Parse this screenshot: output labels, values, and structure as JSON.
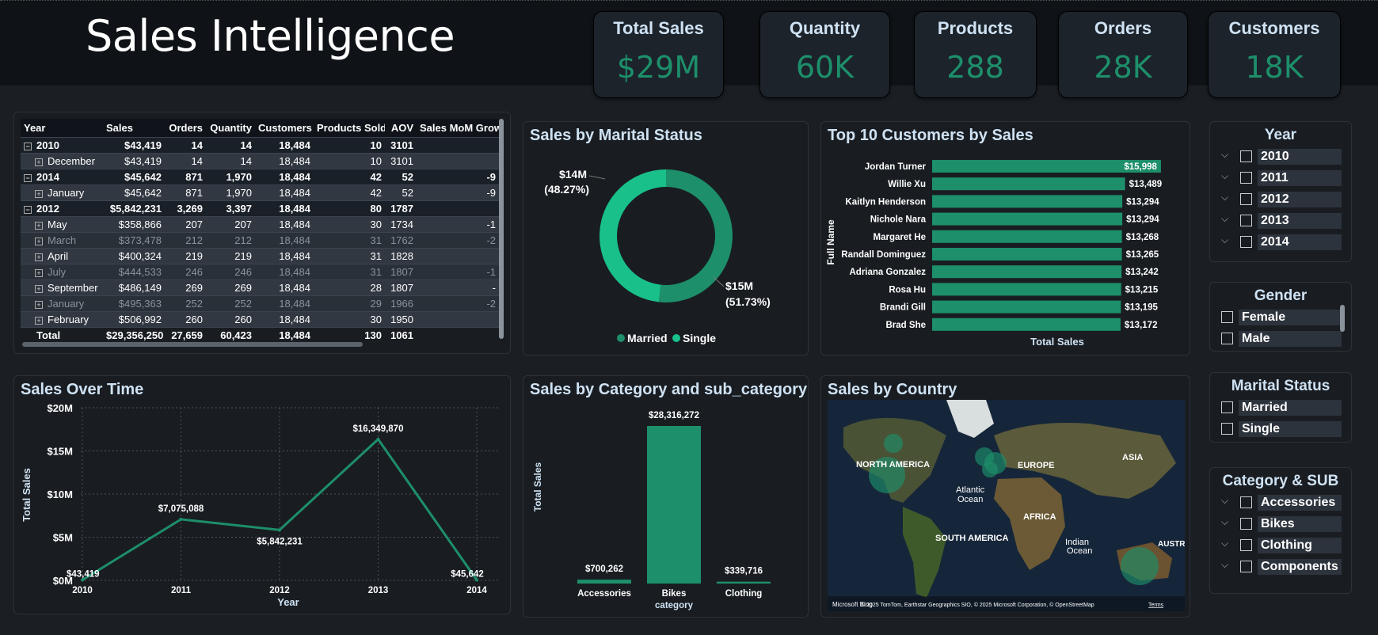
{
  "header": {
    "title": "Sales Intelligence"
  },
  "kpis": [
    {
      "label": "Total Sales",
      "value": "$29M"
    },
    {
      "label": "Quantity",
      "value": "60K"
    },
    {
      "label": "Products",
      "value": "288"
    },
    {
      "label": "Orders",
      "value": "28K"
    },
    {
      "label": "Customers",
      "value": "18K"
    }
  ],
  "matrix": {
    "columns": [
      "Year",
      "Sales",
      "Orders",
      "Quantity",
      "Customers",
      "Products Sold",
      "AOV",
      "Sales MoM Grow"
    ],
    "rows": [
      {
        "kind": "yr",
        "cells": [
          "2010",
          "$43,419",
          "14",
          "14",
          "18,484",
          "10",
          "3101",
          ""
        ]
      },
      {
        "kind": "mo",
        "cells": [
          "December",
          "$43,419",
          "14",
          "14",
          "18,484",
          "10",
          "3101",
          ""
        ]
      },
      {
        "kind": "yr",
        "cells": [
          "2014",
          "$45,642",
          "871",
          "1,970",
          "18,484",
          "42",
          "52",
          "-9"
        ]
      },
      {
        "kind": "mo",
        "cells": [
          "January",
          "$45,642",
          "871",
          "1,970",
          "18,484",
          "42",
          "52",
          "-9"
        ]
      },
      {
        "kind": "yr",
        "cells": [
          "2012",
          "$5,842,231",
          "3,269",
          "3,397",
          "18,484",
          "80",
          "1787",
          ""
        ]
      },
      {
        "kind": "mo",
        "cells": [
          "May",
          "$358,866",
          "207",
          "207",
          "18,484",
          "30",
          "1734",
          "-1"
        ]
      },
      {
        "kind": "mo dim",
        "cells": [
          "March",
          "$373,478",
          "212",
          "212",
          "18,484",
          "31",
          "1762",
          "-2"
        ]
      },
      {
        "kind": "mo",
        "cells": [
          "April",
          "$400,324",
          "219",
          "219",
          "18,484",
          "31",
          "1828",
          ""
        ]
      },
      {
        "kind": "mo dim",
        "cells": [
          "July",
          "$444,533",
          "246",
          "246",
          "18,484",
          "31",
          "1807",
          "-1"
        ]
      },
      {
        "kind": "mo",
        "cells": [
          "September",
          "$486,149",
          "269",
          "269",
          "18,484",
          "28",
          "1807",
          "-"
        ]
      },
      {
        "kind": "mo dim",
        "cells": [
          "January",
          "$495,363",
          "252",
          "252",
          "18,484",
          "29",
          "1966",
          "-2"
        ]
      },
      {
        "kind": "mo",
        "cells": [
          "February",
          "$506,992",
          "260",
          "260",
          "18,484",
          "30",
          "1950",
          ""
        ]
      }
    ],
    "total": [
      "Total",
      "$29,356,250",
      "27,659",
      "60,423",
      "18,484",
      "130",
      "1061",
      ""
    ]
  },
  "marital_chart": {
    "title": "Sales by Marital Status",
    "label_married_value": "$14M",
    "label_married_pct": "(48.27%)",
    "label_single_value": "$15M",
    "label_single_pct": "(51.73%)",
    "legend": [
      "Married",
      "Single"
    ]
  },
  "top_customers": {
    "title": "Top 10 Customers by Sales",
    "ylabel": "Full Name",
    "xlabel": "Total Sales"
  },
  "time_chart": {
    "title": "Sales Over Time",
    "ylabel": "Total Sales",
    "xlabel": "Year",
    "yticks": [
      "$0M",
      "$5M",
      "$10M",
      "$15M",
      "$20M"
    ],
    "xticks": [
      "2010",
      "2011",
      "2012",
      "2013",
      "2014"
    ]
  },
  "category_chart": {
    "title": "Sales by Category and sub_category",
    "ylabel": "Total Sales",
    "xlabel": "category"
  },
  "map": {
    "title": "Sales by Country",
    "labels": [
      "NORTH AMERICA",
      "EUROPE",
      "ASIA",
      "Atlantic",
      "Ocean",
      "AFRICA",
      "SOUTH AMERICA",
      "Indian",
      "Ocean",
      "AUSTRALI"
    ],
    "brand": "Microsoft Bing",
    "credits": "© 2025 TomTom, Earthstar Geographics SIO, © 2025 Microsoft Corporation, © OpenStreetMap",
    "terms": "Terms"
  },
  "slicers": {
    "year": {
      "title": "Year",
      "items": [
        "2010",
        "2011",
        "2012",
        "2013",
        "2014"
      ]
    },
    "gender": {
      "title": "Gender",
      "items": [
        "Female",
        "Male"
      ]
    },
    "marital": {
      "title": "Marital Status",
      "items": [
        "Married",
        "Single"
      ]
    },
    "category": {
      "title": "Category & SUB",
      "items": [
        "Accessories",
        "Bikes",
        "Clothing",
        "Components"
      ]
    }
  },
  "chart_data": [
    {
      "type": "pie",
      "title": "Sales by Marital Status",
      "categories": [
        "Married",
        "Single"
      ],
      "values": [
        14,
        15
      ],
      "percent": [
        48.27,
        51.73
      ],
      "colors": [
        "#19c08a",
        "#1d8f6a"
      ]
    },
    {
      "type": "bar",
      "title": "Top 10 Customers by Sales",
      "orientation": "horizontal",
      "xlabel": "Total Sales",
      "ylabel": "Full Name",
      "categories": [
        "Jordan Turner",
        "Willie Xu",
        "Kaitlyn Henderson",
        "Nichole Nara",
        "Margaret He",
        "Randall Dominguez",
        "Adriana Gonzalez",
        "Rosa Hu",
        "Brandi Gill",
        "Brad She"
      ],
      "values": [
        15998,
        13489,
        13294,
        13294,
        13268,
        13265,
        13242,
        13215,
        13195,
        13172
      ],
      "labels": [
        "$15,998",
        "$13,489",
        "$13,294",
        "$13,294",
        "$13,268",
        "$13,265",
        "$13,242",
        "$13,215",
        "$13,195",
        "$13,172"
      ],
      "xlim": [
        0,
        16500
      ]
    },
    {
      "type": "line",
      "title": "Sales Over Time",
      "xlabel": "Year",
      "ylabel": "Total Sales",
      "x": [
        "2010",
        "2011",
        "2012",
        "2013",
        "2014"
      ],
      "values": [
        43419,
        7075088,
        5842231,
        16349870,
        45642
      ],
      "labels": [
        "$43,419",
        "$7,075,088",
        "$5,842,231",
        "$16,349,870",
        "$45,642"
      ],
      "ylim": [
        0,
        20000000
      ],
      "grid": true
    },
    {
      "type": "bar",
      "title": "Sales by Category and sub_category",
      "xlabel": "category",
      "ylabel": "Total Sales",
      "categories": [
        "Accessories",
        "Bikes",
        "Clothing"
      ],
      "values": [
        700262,
        28316272,
        339716
      ],
      "labels": [
        "$700,262",
        "$28,316,272",
        "$339,716"
      ],
      "ylim": [
        0,
        28316272
      ]
    }
  ]
}
